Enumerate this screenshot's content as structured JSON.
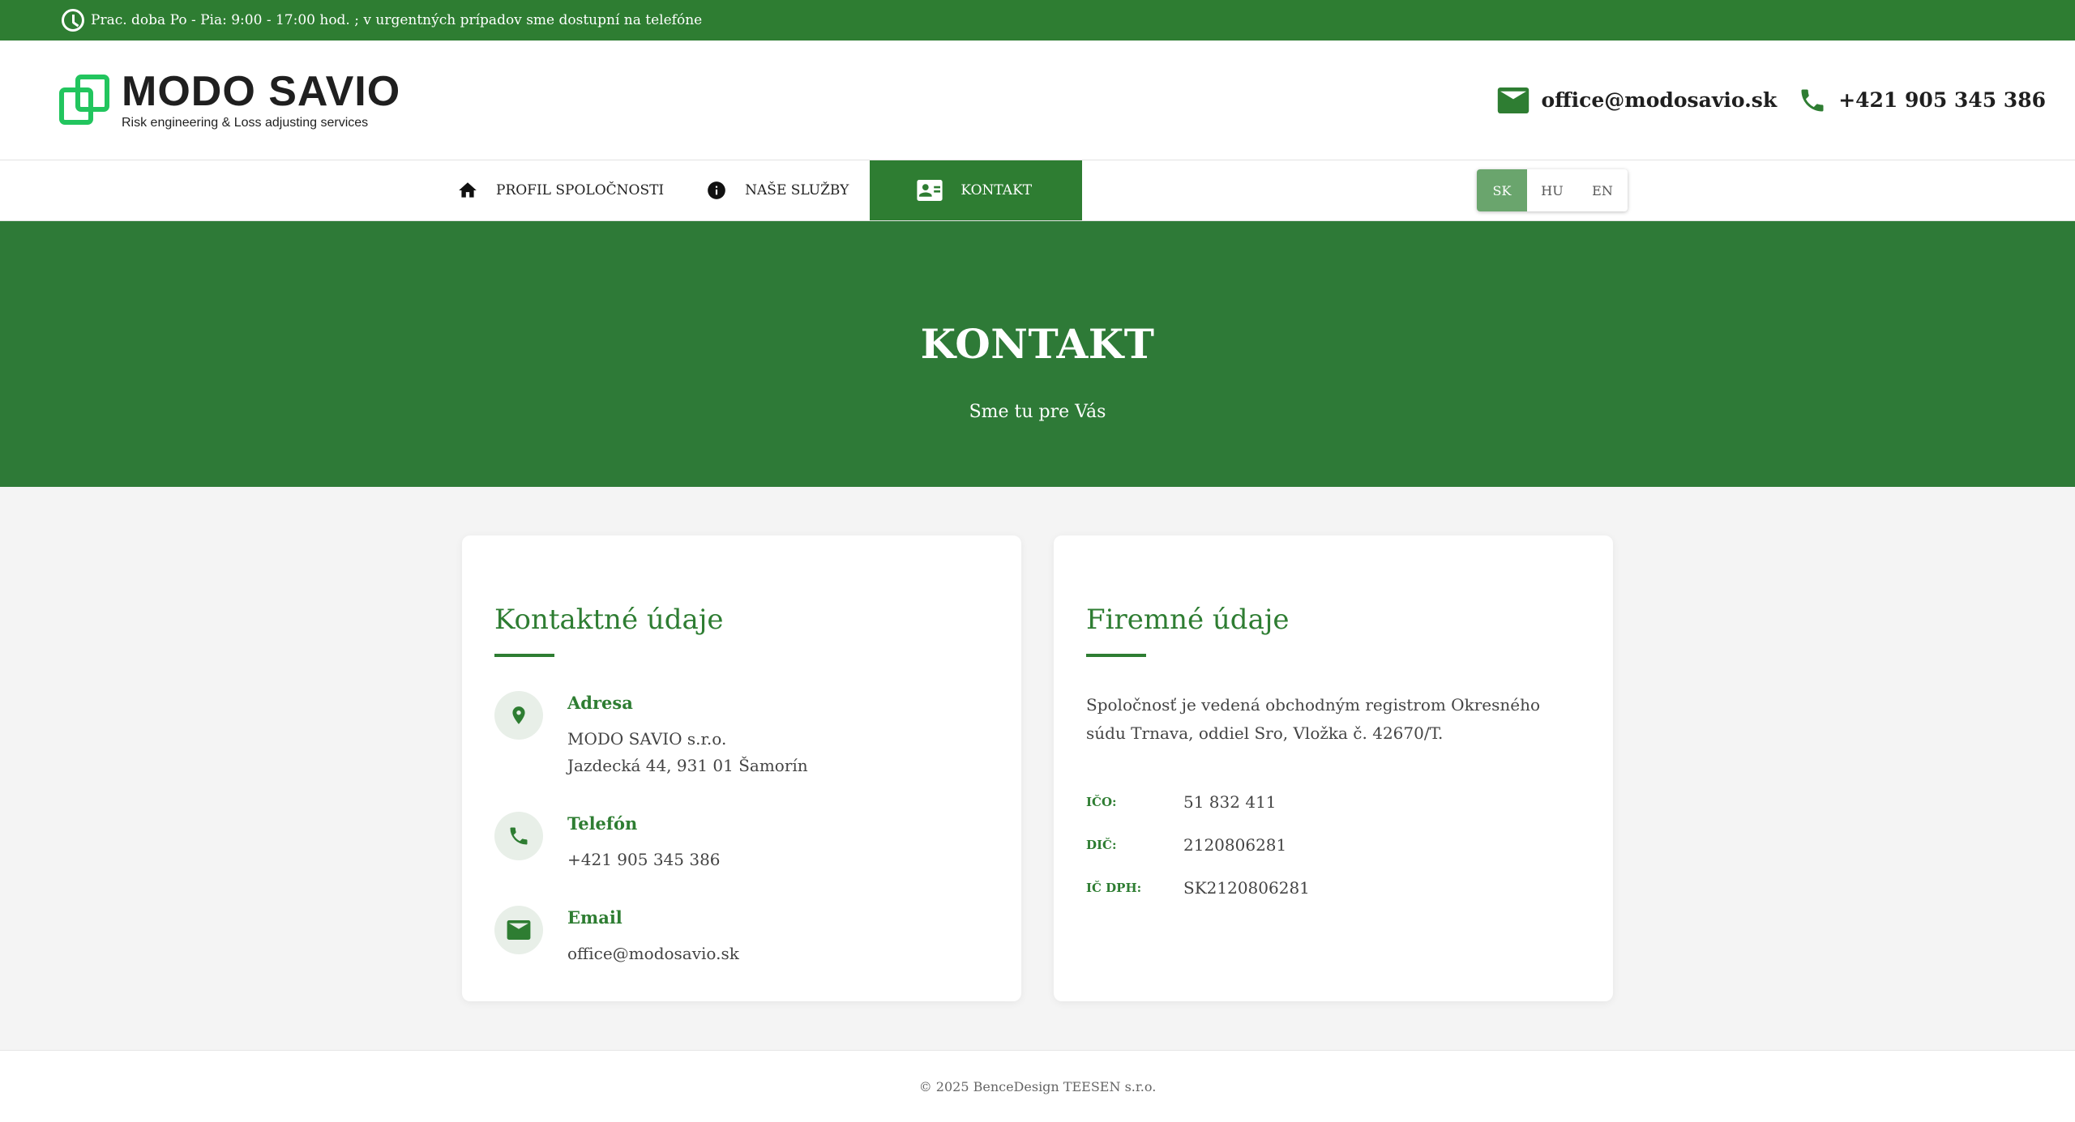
{
  "topbar": {
    "hours": "Prac. doba Po - Pia: 9:00 - 17:00 hod. ; v urgentných prípadov sme dostupní na telefóne"
  },
  "header": {
    "brand": "MODO SAVIO",
    "tagline": "Risk engineering & Loss adjusting services",
    "email": "office@modosavio.sk",
    "phone": "+421 905 345 386"
  },
  "nav": {
    "items": [
      {
        "label": "PROFIL SPOLOČNOSTI",
        "icon": "home-icon"
      },
      {
        "label": "NAŠE SLUŽBY",
        "icon": "info-icon"
      },
      {
        "label": "KONTAKT",
        "icon": "contact-card-icon"
      }
    ],
    "languages": [
      "SK",
      "HU",
      "EN"
    ],
    "selected_language": "SK"
  },
  "hero": {
    "title": "KONTAKT",
    "subtitle": "Sme tu pre Vás"
  },
  "contact_card": {
    "title": "Kontaktné údaje",
    "address": {
      "label": "Adresa",
      "line1": "MODO SAVIO s.r.o.",
      "line2": "Jazdecká 44, 931 01 Šamorín"
    },
    "phone": {
      "label": "Telefón",
      "value": "+421 905 345 386"
    },
    "email": {
      "label": "Email",
      "value": "office@modosavio.sk"
    }
  },
  "company_card": {
    "title": "Firemné údaje",
    "description": "Spoločnosť je vedená obchodným registrom Okresného súdu Trnava, oddiel Sro, Vložka č. 42670/T.",
    "rows": [
      {
        "key": "IČO:",
        "value": "51 832 411"
      },
      {
        "key": "DIČ:",
        "value": "2120806281"
      },
      {
        "key": "IČ DPH:",
        "value": "SK2120806281"
      }
    ]
  },
  "footer": {
    "copyright": "© 2025 BenceDesign TEESEN s.r.o."
  },
  "colors": {
    "brand_green": "#2e7d32",
    "logo_green": "#22c55e",
    "lang_selected": "#6aa56d"
  }
}
